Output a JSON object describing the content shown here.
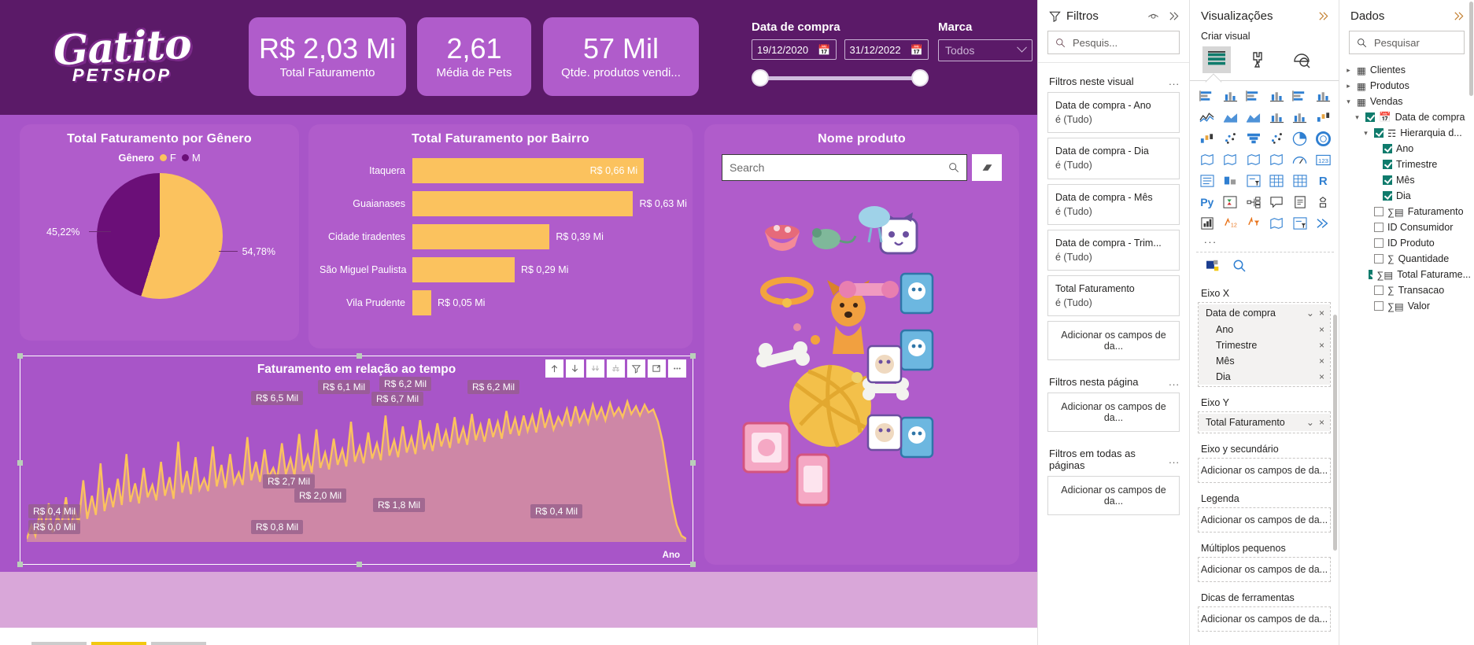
{
  "brand": {
    "logo_name": "Gatito",
    "logo_sub": "PETSHOP",
    "colors": {
      "header_purple": "#5b1a68",
      "card_purple": "#b05ccb",
      "canvas_purple": "#a855c8",
      "yellow": "#fbc25e",
      "dark_purple": "#6b0f78"
    }
  },
  "kpis": [
    {
      "value": "R$ 2,03 Mi",
      "label": "Total Faturamento"
    },
    {
      "value": "2,61",
      "label": "Média de Pets"
    },
    {
      "value": "57 Mil",
      "label": "Qtde. produtos vendi..."
    }
  ],
  "date_slicer": {
    "title": "Data de compra",
    "start": "19/12/2020",
    "end": "31/12/2022",
    "calendar_icon": "calendar-icon"
  },
  "marca_slicer": {
    "title": "Marca",
    "value": "Todos"
  },
  "chart_data": [
    {
      "type": "pie",
      "title": "Total Faturamento por Gênero",
      "legend_title": "Gênero",
      "legend_position": "top",
      "labels": [
        "F",
        "M"
      ],
      "values": [
        54.78,
        45.22
      ],
      "value_labels": [
        "54,78%",
        "45,22%"
      ],
      "colors": [
        "#fbc25e",
        "#6b0f78"
      ]
    },
    {
      "type": "bar",
      "title": "Total Faturamento por Bairro",
      "orientation": "horizontal",
      "categories": [
        "Itaquera",
        "Guaianases",
        "Cidade tiradentes",
        "São Miguel Paulista",
        "Vila Prudente"
      ],
      "values": [
        0.66,
        0.63,
        0.39,
        0.29,
        0.05
      ],
      "value_labels": [
        "R$ 0,66 Mi",
        "R$ 0,63 Mi",
        "R$ 0,39 Mi",
        "R$ 0,29 Mi",
        "R$ 0,05 Mi"
      ],
      "xlabel": "",
      "ylabel": "",
      "xlim": [
        0,
        0.7
      ],
      "grid": false,
      "bar_color": "#fbc25e"
    },
    {
      "type": "line",
      "title": "Faturamento em relação ao tempo",
      "xlabel": "Ano",
      "ylabel": "",
      "grid": false,
      "series_color": "#fbc25e",
      "area_color": "#d98f9e",
      "annotations": [
        "R$ 6,5 Mil",
        "R$ 6,1 Mil",
        "R$ 6,2 Mil",
        "R$ 6,7 Mil",
        "R$ 6,2 Mil",
        "R$ 2,7 Mil",
        "R$ 2,0 Mil",
        "R$ 1,8 Mil",
        "R$ 0,4 Mil",
        "R$ 0,0 Mil",
        "R$ 0,8 Mil",
        "R$ 0,4 Mil"
      ],
      "toolbar": [
        "drill-up-icon",
        "drill-down-icon",
        "drill-all-icon",
        "expand-hierarchy-icon",
        "filter-icon",
        "focus-mode-icon",
        "more-options-icon"
      ]
    }
  ],
  "product_card": {
    "title": "Nome produto",
    "search_placeholder": "Search",
    "search_icon": "search-icon",
    "clear_icon": "eraser-icon"
  },
  "filters_pane": {
    "title": "Filtros",
    "icon": "filter-icon",
    "eye_icon": "eye-icon",
    "collapse_icon": "chevron-double-right-icon",
    "search_placeholder": "Pesquis...",
    "sections": [
      {
        "label": "Filtros neste visual",
        "menu": "...",
        "cards": [
          {
            "field": "Data de compra - Ano",
            "state": "é (Tudo)"
          },
          {
            "field": "Data de compra - Dia",
            "state": "é (Tudo)"
          },
          {
            "field": "Data de compra - Mês",
            "state": "é (Tudo)"
          },
          {
            "field": "Data de compra - Trim...",
            "state": "é (Tudo)"
          },
          {
            "field": "Total Faturamento",
            "state": "é (Tudo)"
          }
        ],
        "dropzone": "Adicionar os campos de da..."
      },
      {
        "label": "Filtros nesta página",
        "menu": "...",
        "cards": [],
        "dropzone": "Adicionar os campos de da..."
      },
      {
        "label": "Filtros em todas as páginas",
        "menu": "...",
        "cards": [],
        "dropzone": "Adicionar os campos de da..."
      }
    ]
  },
  "viz_pane": {
    "title": "Visualizações",
    "collapse_icon": "chevron-double-right-icon",
    "subtitle": "Criar visual",
    "modes": [
      "build-visual-icon",
      "format-visual-icon",
      "analytics-icon"
    ],
    "gallery": [
      "stacked-bar-chart-icon",
      "stacked-column-chart-icon",
      "clustered-bar-chart-icon",
      "clustered-column-chart-icon",
      "100-stacked-bar-chart-icon",
      "100-stacked-column-chart-icon",
      "line-chart-icon",
      "area-chart-icon",
      "stacked-area-chart-icon",
      "line-stacked-column-icon",
      "line-clustered-column-icon",
      "ribbon-chart-icon",
      "waterfall-chart-icon",
      "scatter-chart-icon",
      "funnel-chart-icon",
      "scatter-plot-icon",
      "pie-chart-icon",
      "donut-chart-icon",
      "treemap-icon",
      "map-icon",
      "filled-map-icon",
      "arcgis-map-icon",
      "gauge-icon",
      "card-icon",
      "multi-row-card-icon",
      "kpi-icon",
      "slicer-icon",
      "table-icon",
      "matrix-icon",
      "r-script-icon",
      "python-script-icon",
      "key-influencers-icon",
      "decomposition-tree-icon",
      "qna-icon",
      "smart-narrative-icon",
      "paginated-report-icon",
      "metrics-icon",
      "power-apps-icon",
      "power-automate-icon",
      "azure-map-icon",
      "chiclet-slicer-icon",
      "flow-icon"
    ],
    "more": "...",
    "tools": [
      "format-paint-icon",
      "analytics-magnifier-icon"
    ],
    "wells": [
      {
        "label": "Eixo X",
        "fields": [
          {
            "name": "Data de compra",
            "chevron": "chevron-down-icon",
            "remove": "×",
            "children": [
              {
                "name": "Ano",
                "remove": "×"
              },
              {
                "name": "Trimestre",
                "remove": "×"
              },
              {
                "name": "Mês",
                "remove": "×"
              },
              {
                "name": "Dia",
                "remove": "×"
              }
            ]
          }
        ]
      },
      {
        "label": "Eixo Y",
        "fields": [
          {
            "name": "Total Faturamento",
            "chevron": "chevron-down-icon",
            "remove": "×",
            "children": []
          }
        ]
      },
      {
        "label": "Eixo y secundário",
        "placeholder": "Adicionar os campos de da..."
      },
      {
        "label": "Legenda",
        "placeholder": "Adicionar os campos de da..."
      },
      {
        "label": "Múltiplos pequenos",
        "placeholder": "Adicionar os campos de da..."
      },
      {
        "label": "Dicas de ferramentas",
        "placeholder": "Adicionar os campos de da..."
      }
    ]
  },
  "data_pane": {
    "title": "Dados",
    "collapse_icon": "chevron-double-right-icon",
    "search_placeholder": "Pesquisar",
    "tree": [
      {
        "label": "Clientes",
        "depth": 0,
        "expander": "collapsed",
        "icon": "table-icon",
        "checkbox": "none"
      },
      {
        "label": "Produtos",
        "depth": 0,
        "expander": "collapsed",
        "icon": "table-icon",
        "checkbox": "none"
      },
      {
        "label": "Vendas",
        "depth": 0,
        "expander": "expanded",
        "icon": "table-icon",
        "checkbox": "none"
      },
      {
        "label": "Data de compra",
        "depth": 1,
        "expander": "expanded",
        "icon": "date-table-icon",
        "checkbox": "checked"
      },
      {
        "label": "Hierarquia d...",
        "depth": 2,
        "expander": "expanded",
        "icon": "hierarchy-icon",
        "checkbox": "checked"
      },
      {
        "label": "Ano",
        "depth": 3,
        "expander": "none",
        "icon": "none",
        "checkbox": "checked"
      },
      {
        "label": "Trimestre",
        "depth": 3,
        "expander": "none",
        "icon": "none",
        "checkbox": "checked"
      },
      {
        "label": "Mês",
        "depth": 3,
        "expander": "none",
        "icon": "none",
        "checkbox": "checked"
      },
      {
        "label": "Dia",
        "depth": 3,
        "expander": "none",
        "icon": "none",
        "checkbox": "checked"
      },
      {
        "label": "Faturamento",
        "depth": 2,
        "expander": "none",
        "icon": "measure-icon",
        "checkbox": "unchecked"
      },
      {
        "label": "ID Consumidor",
        "depth": 2,
        "expander": "none",
        "icon": "none",
        "checkbox": "unchecked"
      },
      {
        "label": "ID Produto",
        "depth": 2,
        "expander": "none",
        "icon": "none",
        "checkbox": "unchecked"
      },
      {
        "label": "Quantidade",
        "depth": 2,
        "expander": "none",
        "icon": "sigma-icon",
        "checkbox": "unchecked"
      },
      {
        "label": "Total Faturame...",
        "depth": 2,
        "expander": "none",
        "icon": "measure-icon",
        "checkbox": "checked"
      },
      {
        "label": "Transacao",
        "depth": 2,
        "expander": "none",
        "icon": "sigma-icon",
        "checkbox": "unchecked"
      },
      {
        "label": "Valor",
        "depth": 2,
        "expander": "none",
        "icon": "measure-icon",
        "checkbox": "unchecked"
      }
    ]
  }
}
